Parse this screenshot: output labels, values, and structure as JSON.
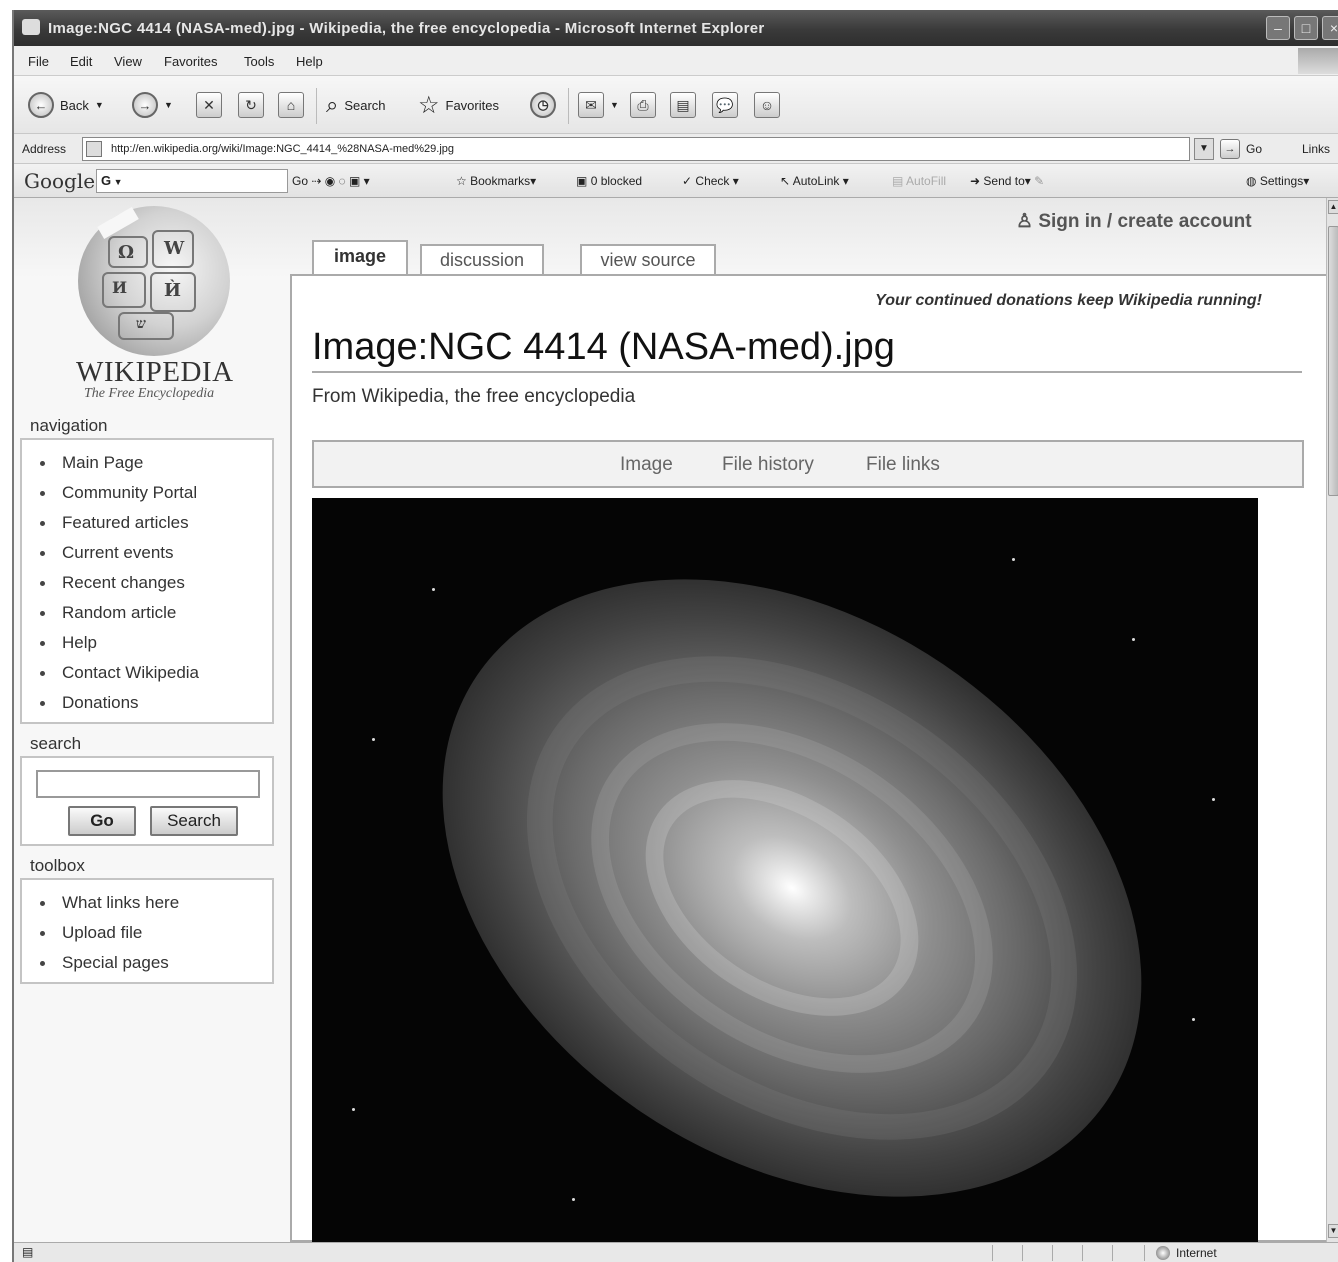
{
  "window": {
    "title": "Image:NGC 4414 (NASA-med).jpg - Wikipedia, the free encyclopedia - Microsoft Internet Explorer"
  },
  "menu": [
    "File",
    "Edit",
    "View",
    "Favorites",
    "Tools",
    "Help"
  ],
  "toolbar": {
    "back_label": "Back",
    "search_label": "Search",
    "favorites_label": "Favorites"
  },
  "address": {
    "label": "Address",
    "url": "http://en.wikipedia.org/wiki/Image:NGC_4414_%28NASA-med%29.jpg",
    "go_label": "Go",
    "links_label": "Links"
  },
  "google_toolbar": {
    "logo": "Google",
    "field_text": "G",
    "go_label": "Go",
    "bookmarks_label": "Bookmarks",
    "blocked_label": "0 blocked",
    "check_label": "Check",
    "autolink_label": "AutoLink",
    "autofill_label": "AutoFill",
    "sendto_label": "Send to",
    "settings_label": "Settings"
  },
  "wiki": {
    "wordmark": "WIKIPEDIA",
    "tagline": "The Free Encyclopedia",
    "personal": "Sign in / create account",
    "tabs": [
      "image",
      "discussion",
      "view source"
    ],
    "sitenotice": "Your continued donations keep Wikipedia running!",
    "heading": "Image:NGC 4414 (NASA-med).jpg",
    "sitesub": "From Wikipedia, the free encyclopedia",
    "filetoc": [
      "Image",
      "File history",
      "File links"
    ],
    "navigation": {
      "title": "navigation",
      "items": [
        "Main Page",
        "Community Portal",
        "Featured articles",
        "Current events",
        "Recent changes",
        "Random article",
        "Help",
        "Contact Wikipedia",
        "Donations"
      ]
    },
    "search": {
      "title": "search",
      "go_label": "Go",
      "search_label": "Search"
    },
    "toolbox": {
      "title": "toolbox",
      "items": [
        "What links here",
        "Upload file",
        "Special pages"
      ]
    }
  },
  "status": {
    "zone": "Internet"
  }
}
